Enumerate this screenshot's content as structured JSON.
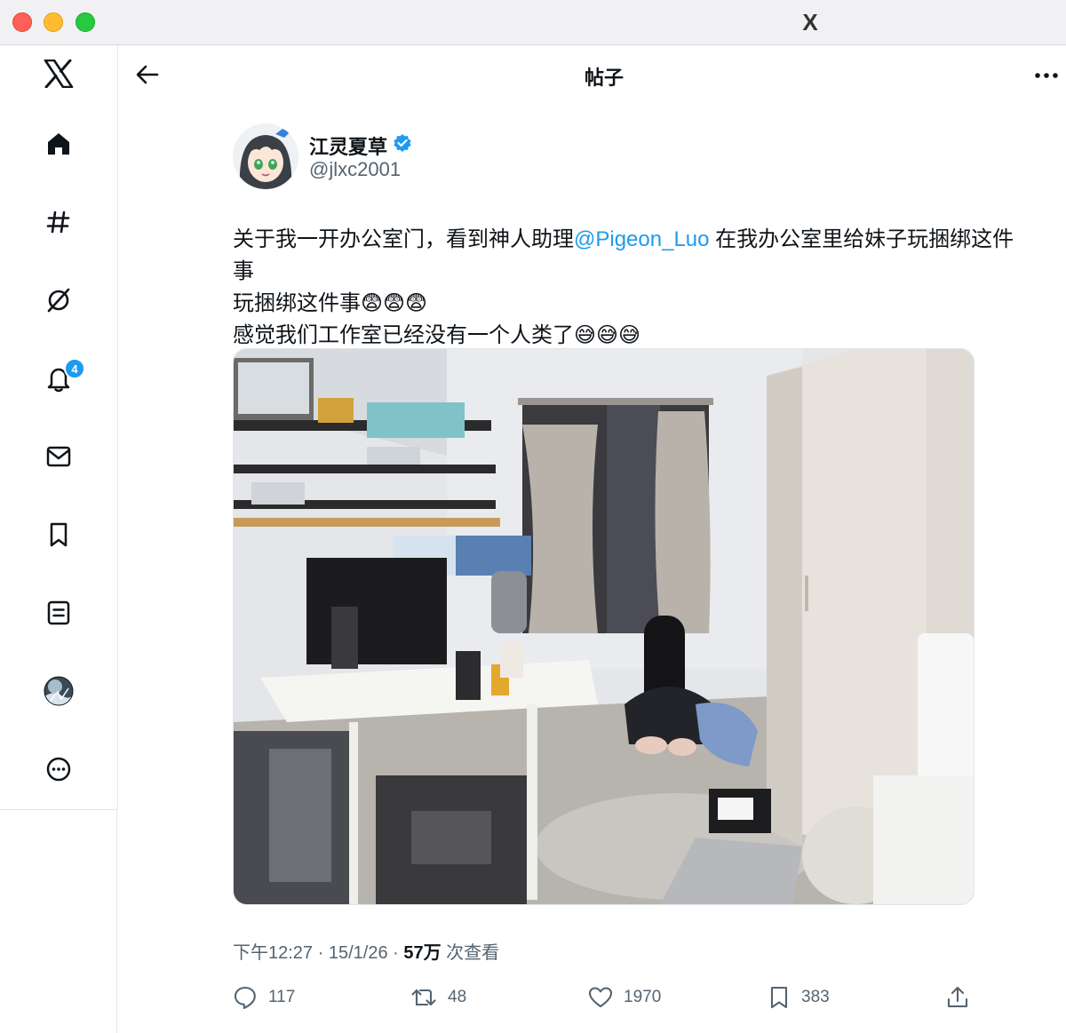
{
  "window": {
    "title": "X"
  },
  "sidebar": {
    "items": [
      {
        "name": "home"
      },
      {
        "name": "explore"
      },
      {
        "name": "grok"
      },
      {
        "name": "notifications",
        "badge": "4"
      },
      {
        "name": "messages"
      },
      {
        "name": "bookmarks"
      },
      {
        "name": "lists"
      },
      {
        "name": "profile"
      },
      {
        "name": "more"
      }
    ],
    "accent": "#1d9bf0"
  },
  "header": {
    "title": "帖子"
  },
  "author": {
    "display_name": "江灵夏草",
    "handle": "@jlxc2001",
    "verified": true
  },
  "tweet": {
    "text_1": "关于我一开办公室门，看到神人助理",
    "mention": "@Pigeon_Luo",
    "text_2": " 在我办公室里给妹子玩捆绑这件事",
    "emoji_1": "😨😨😨",
    "text_3": "感觉我们工作室已经没有一个人类了",
    "emoji_2": "😅😅😅"
  },
  "meta": {
    "time": "下午12:27",
    "sep1": " · ",
    "date": "15/1/26",
    "sep2": " · ",
    "views": "57万",
    "views_label": " 次查看"
  },
  "actions": {
    "replies": "117",
    "reposts": "48",
    "likes": "1970",
    "bookmarks": "383"
  }
}
